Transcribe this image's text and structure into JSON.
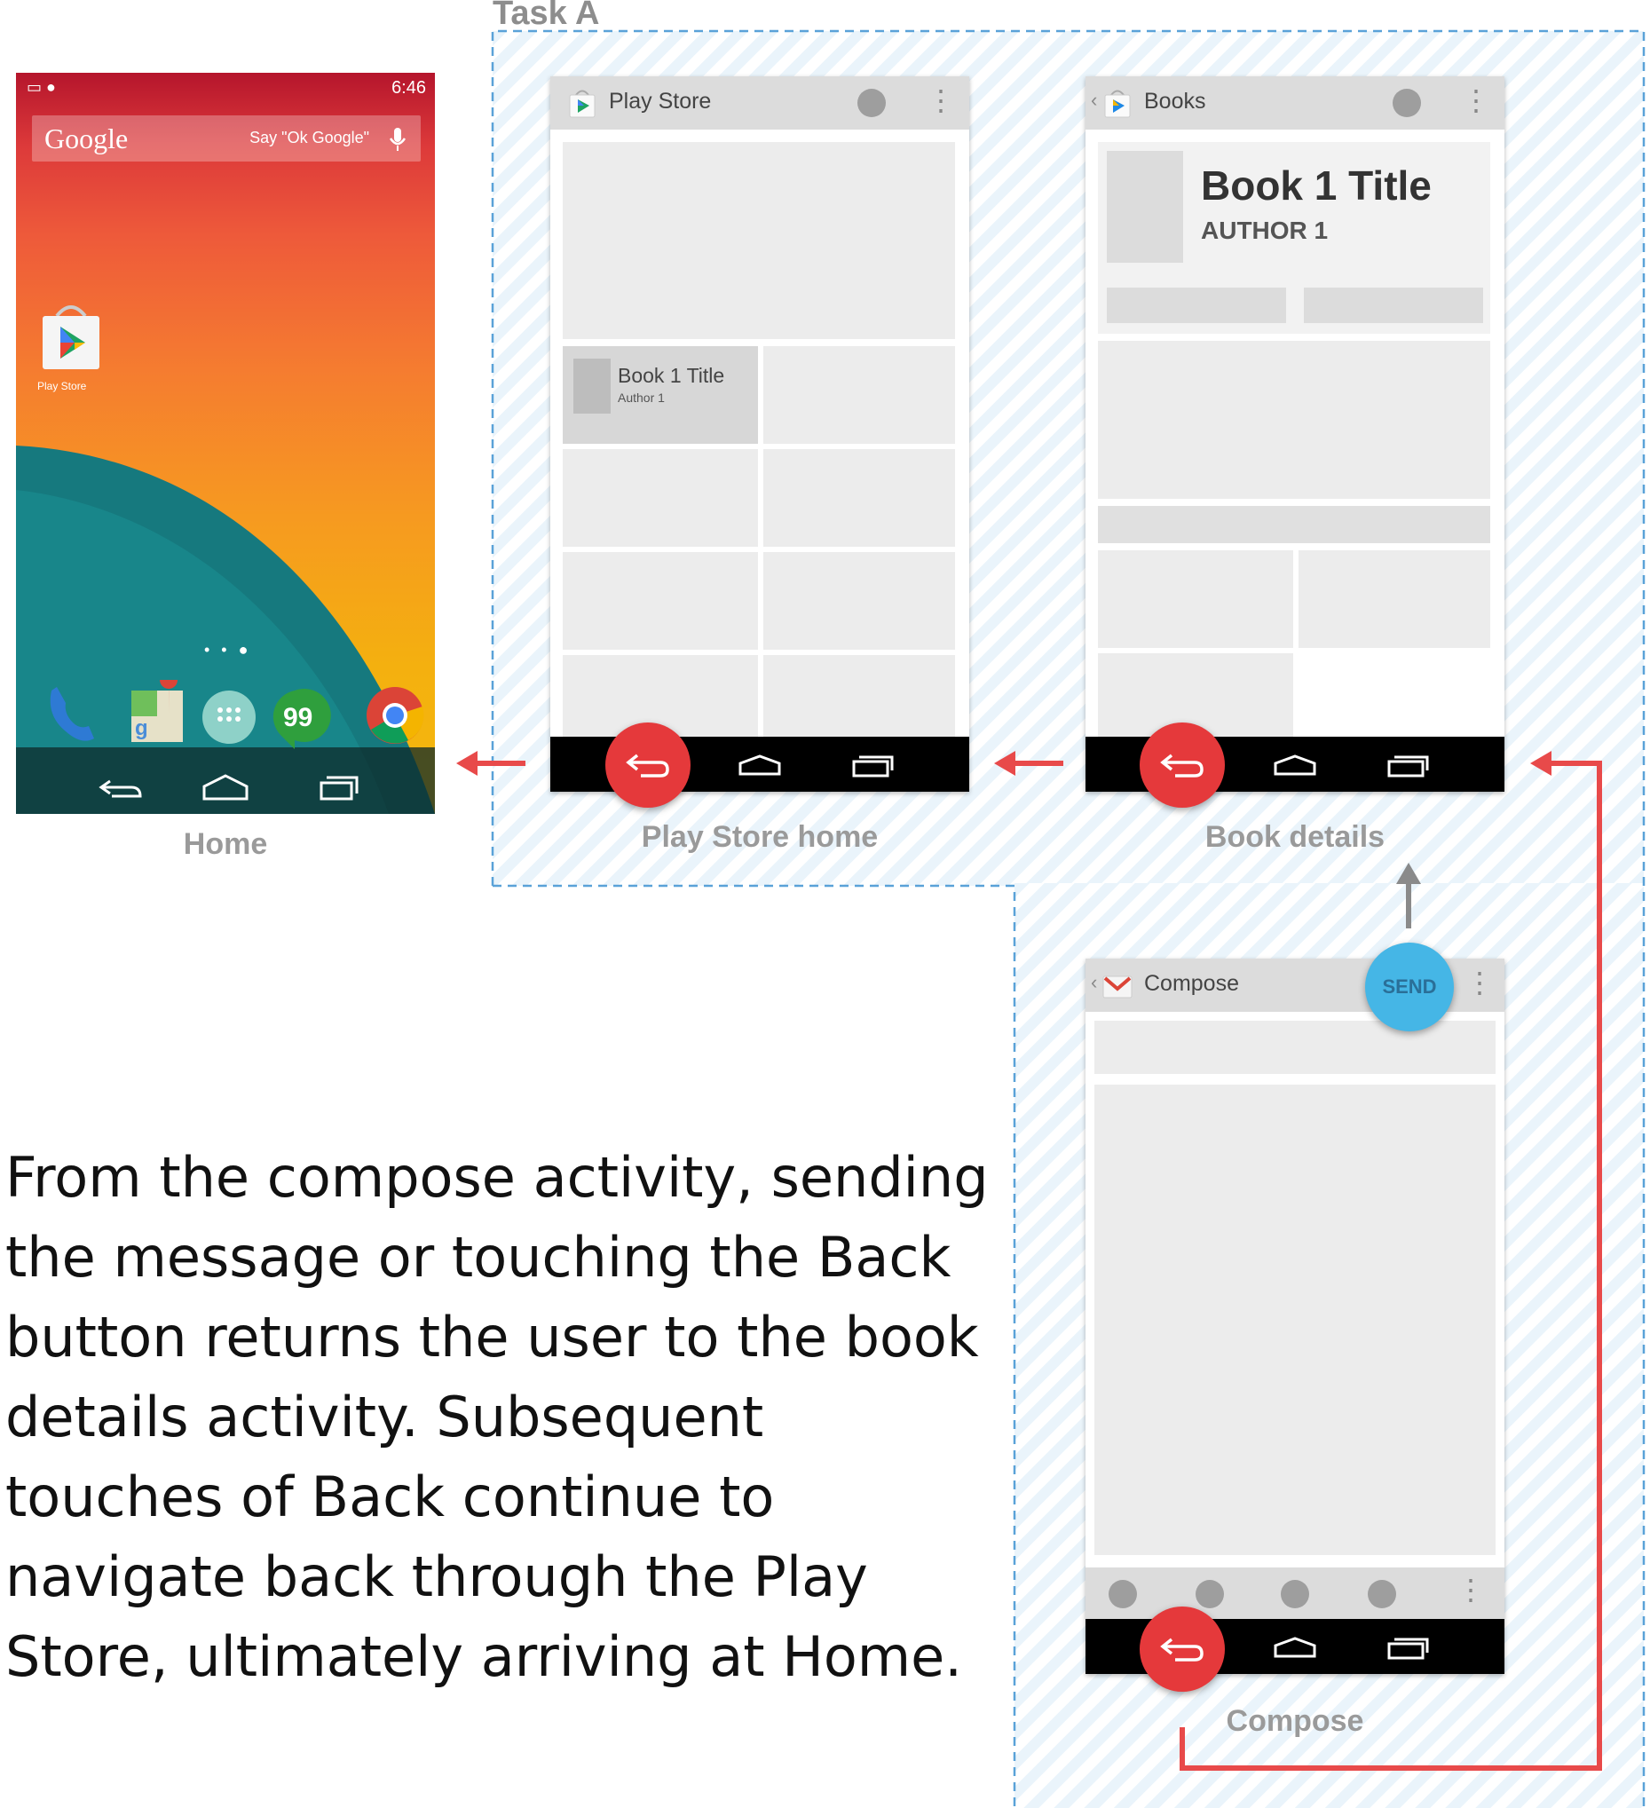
{
  "task_label": "Task A",
  "home": {
    "status_time": "6:46",
    "search_word": "Google",
    "search_hint": "Say \"Ok Google\"",
    "app_label": "Play Store",
    "page_dots": "• • ●",
    "caption": "Home"
  },
  "play_store": {
    "app_title": "Play Store",
    "card_title": "Book 1 Title",
    "card_author": "Author 1",
    "caption": "Play Store home"
  },
  "book_details": {
    "app_title": "Books",
    "book_title": "Book 1 Title",
    "book_author": "AUTHOR 1",
    "caption": "Book details"
  },
  "compose": {
    "app_title": "Compose",
    "send_label": "SEND",
    "caption": "Compose"
  },
  "description": "From the compose activity, sending the message or touching the Back button returns the user to the book details activity. Subsequent touches of Back continue to navigate back through the Play Store, ultimately arriving at Home.",
  "colors": {
    "back_button": "#e5393b",
    "send_button": "#45b6e6",
    "flow_arrow": "#e84a4a",
    "up_arrow": "#8a8a8a",
    "task_outline": "#5aa2d8"
  },
  "icons": {
    "back": "back-arrow-icon",
    "home": "home-icon",
    "recents": "recents-icon",
    "overflow": "overflow-menu-icon"
  }
}
